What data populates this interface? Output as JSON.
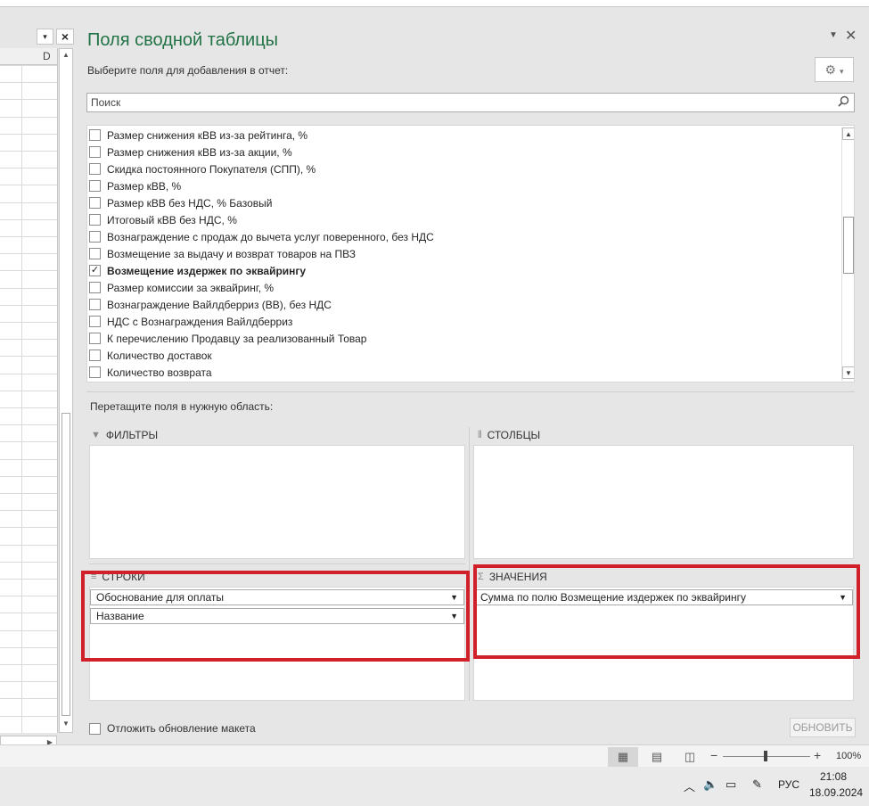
{
  "sheet": {
    "column_label": "D",
    "dropdown_glyph": "▾",
    "close_glyph": "×"
  },
  "pane": {
    "title": "Поля сводной таблицы",
    "subtitle": "Выберите поля для добавления в отчет:",
    "search_placeholder": "Поиск",
    "fields": [
      {
        "label": "Размер снижения кВВ из-за рейтинга, %",
        "checked": false
      },
      {
        "label": "Размер снижения кВВ из-за акции, %",
        "checked": false
      },
      {
        "label": "Скидка постоянного Покупателя (СПП), %",
        "checked": false
      },
      {
        "label": "Размер кВВ, %",
        "checked": false
      },
      {
        "label": "Размер  кВВ без НДС, % Базовый",
        "checked": false
      },
      {
        "label": "Итоговый кВВ без НДС, %",
        "checked": false
      },
      {
        "label": "Вознаграждение с продаж до вычета услуг поверенного, без НДС",
        "checked": false
      },
      {
        "label": "Возмещение за выдачу и возврат товаров на ПВЗ",
        "checked": false
      },
      {
        "label": "Возмещение издержек по эквайрингу",
        "checked": true
      },
      {
        "label": "Размер комиссии за эквайринг, %",
        "checked": false
      },
      {
        "label": "Вознаграждение Вайлдберриз (ВВ), без НДС",
        "checked": false
      },
      {
        "label": "НДС с Вознаграждения Вайлдберриз",
        "checked": false
      },
      {
        "label": "К перечислению Продавцу за реализованный Товар",
        "checked": false
      },
      {
        "label": "Количество доставок",
        "checked": false
      },
      {
        "label": "Количество возврата",
        "checked": false
      }
    ],
    "drag_hint": "Перетащите поля в нужную область:",
    "areas": {
      "filters": "ФИЛЬТРЫ",
      "columns": "СТОЛБЦЫ",
      "rows": "СТРОКИ",
      "values": "ЗНАЧЕНИЯ"
    },
    "rows_items": [
      "Обоснование для оплаты",
      "Название"
    ],
    "values_items": [
      "Сумма по полю Возмещение издержек по эквайрингу"
    ],
    "defer_label": "Отложить обновление макета",
    "update_button": "ОБНОВИТЬ",
    "highlight_color": "#d0202a"
  },
  "statusbar": {
    "zoom_level": "100%",
    "zoom_percent": 100
  },
  "taskbar": {
    "language": "РУС",
    "time": "21:08",
    "date": "18.09.2024"
  }
}
